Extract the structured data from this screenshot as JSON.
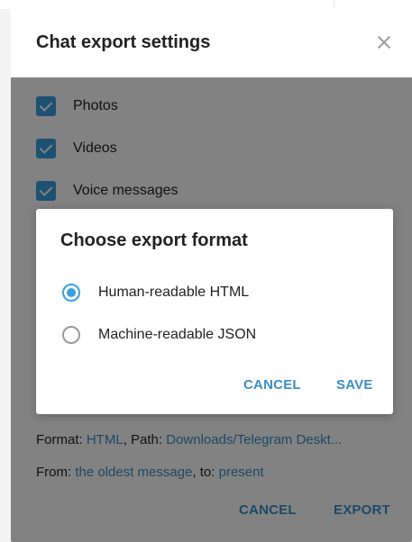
{
  "settings": {
    "title": "Chat export settings",
    "checkboxes": [
      {
        "label": "Photos",
        "checked": true
      },
      {
        "label": "Videos",
        "checked": true
      },
      {
        "label": "Voice messages",
        "checked": true
      }
    ],
    "format_prefix": "Format: ",
    "format_value": "HTML",
    "path_prefix": ", Path: ",
    "path_value": "Downloads/Telegram Deskt...",
    "from_prefix": "From: ",
    "from_value": "the oldest message",
    "to_prefix": ", to: ",
    "to_value": "present",
    "cancel_label": "CANCEL",
    "export_label": "EXPORT"
  },
  "modal": {
    "title": "Choose export format",
    "options": [
      {
        "label": "Human-readable HTML",
        "selected": true
      },
      {
        "label": "Machine-readable JSON",
        "selected": false
      }
    ],
    "cancel_label": "CANCEL",
    "save_label": "SAVE"
  },
  "colors": {
    "accent": "#3aa0e0",
    "link": "#3a8fc7",
    "overlay": "#000000"
  },
  "icons": {
    "close": "close-icon",
    "check": "checkmark-icon"
  }
}
